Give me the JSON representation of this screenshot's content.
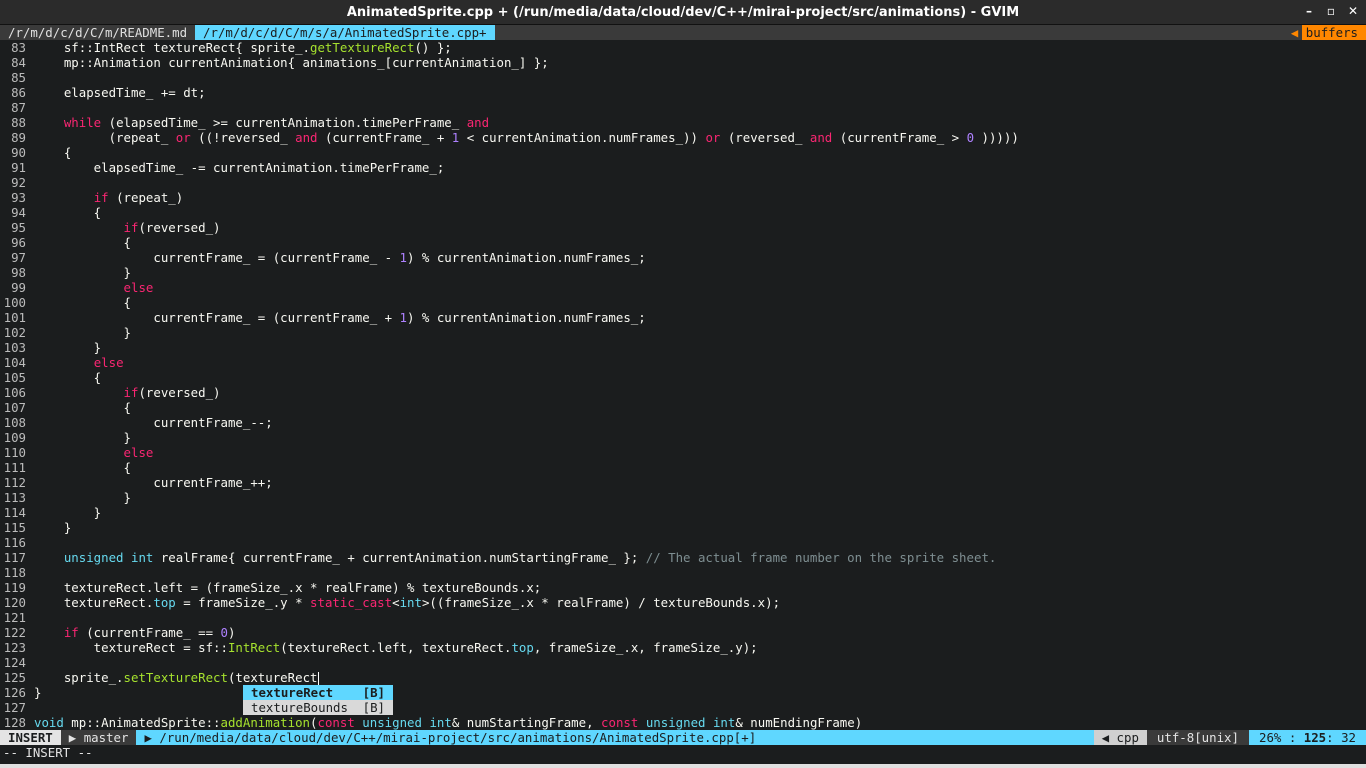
{
  "window": {
    "title": "AnimatedSprite.cpp + (/run/media/data/cloud/dev/C++/mirai-project/src/animations) - GVIM",
    "controls": [
      "–",
      "▫",
      "✕"
    ]
  },
  "tabline": {
    "tabs": [
      {
        "label": "/r/m/d/c/d/C/m/README.md",
        "active": false
      },
      {
        "label": "/r/m/d/c/d/C/m/s/a/AnimatedSprite.cpp+",
        "active": true
      }
    ],
    "right_label": "buffers"
  },
  "editor": {
    "lines": [
      {
        "n": "83",
        "html": "    sf::IntRect textureRect{ sprite_.<span class=\"fn\">getTextureRect</span>() };"
      },
      {
        "n": "84",
        "html": "    mp::Animation currentAnimation{ animations_[currentAnimation_] };"
      },
      {
        "n": "85",
        "html": ""
      },
      {
        "n": "86",
        "html": "    elapsedTime_ += dt;"
      },
      {
        "n": "87",
        "html": ""
      },
      {
        "n": "88",
        "html": "    <span class=\"kw\">while</span> (elapsedTime_ &gt;= currentAnimation.timePerFrame_ <span class=\"kw\">and</span>"
      },
      {
        "n": "89",
        "html": "          (repeat_ <span class=\"kw\">or</span> ((!reversed_ <span class=\"kw\">and</span> (currentFrame_ + <span class=\"num\">1</span> &lt; currentAnimation.numFrames_)) <span class=\"kw\">or</span> (reversed_ <span class=\"kw\">and</span> (currentFrame_ &gt; <span class=\"num\">0</span> )))))"
      },
      {
        "n": "90",
        "html": "    {"
      },
      {
        "n": "91",
        "html": "        elapsedTime_ -= currentAnimation.timePerFrame_;"
      },
      {
        "n": "92",
        "html": ""
      },
      {
        "n": "93",
        "html": "        <span class=\"kw\">if</span> (repeat_)"
      },
      {
        "n": "94",
        "html": "        {"
      },
      {
        "n": "95",
        "html": "            <span class=\"kw\">if</span>(reversed_)"
      },
      {
        "n": "96",
        "html": "            {"
      },
      {
        "n": "97",
        "html": "                currentFrame_ = (currentFrame_ - <span class=\"num\">1</span>) % currentAnimation.numFrames_;"
      },
      {
        "n": "98",
        "html": "            }"
      },
      {
        "n": "99",
        "html": "            <span class=\"kw\">else</span>"
      },
      {
        "n": "100",
        "html": "            {"
      },
      {
        "n": "101",
        "html": "                currentFrame_ = (currentFrame_ + <span class=\"num\">1</span>) % currentAnimation.numFrames_;"
      },
      {
        "n": "102",
        "html": "            }"
      },
      {
        "n": "103",
        "html": "        }"
      },
      {
        "n": "104",
        "html": "        <span class=\"kw\">else</span>"
      },
      {
        "n": "105",
        "html": "        {"
      },
      {
        "n": "106",
        "html": "            <span class=\"kw\">if</span>(reversed_)"
      },
      {
        "n": "107",
        "html": "            {"
      },
      {
        "n": "108",
        "html": "                currentFrame_--;"
      },
      {
        "n": "109",
        "html": "            }"
      },
      {
        "n": "110",
        "html": "            <span class=\"kw\">else</span>"
      },
      {
        "n": "111",
        "html": "            {"
      },
      {
        "n": "112",
        "html": "                currentFrame_++;"
      },
      {
        "n": "113",
        "html": "            }"
      },
      {
        "n": "114",
        "html": "        }"
      },
      {
        "n": "115",
        "html": "    }"
      },
      {
        "n": "116",
        "html": ""
      },
      {
        "n": "117",
        "html": "    <span class=\"ty\">unsigned</span> <span class=\"ty\">int</span> realFrame{ currentFrame_ + currentAnimation.numStartingFrame_ }; <span class=\"cm\">// The actual frame number on the sprite sheet.</span>"
      },
      {
        "n": "118",
        "html": ""
      },
      {
        "n": "119",
        "html": "    textureRect.left = (frameSize_.x * realFrame) % textureBounds.x;"
      },
      {
        "n": "120",
        "html": "    textureRect.<span class=\"ty\">top</span> = frameSize_.y * <span class=\"kw\">static_cast</span>&lt;<span class=\"ty\">int</span>&gt;((frameSize_.x * realFrame) / textureBounds.x);"
      },
      {
        "n": "121",
        "html": ""
      },
      {
        "n": "122",
        "html": "    <span class=\"kw\">if</span> (currentFrame_ == <span class=\"num\">0</span>)"
      },
      {
        "n": "123",
        "html": "        textureRect = sf::<span class=\"fn\">IntRect</span>(textureRect.left, textureRect.<span class=\"ty\">top</span>, frameSize_.x, frameSize_.y);"
      },
      {
        "n": "124",
        "html": ""
      },
      {
        "n": "125",
        "html": "    sprite_.<span class=\"fn\">setTextureRect</span>(textureRect<span class=\"cursor\"></span>"
      },
      {
        "n": "126",
        "html": "}"
      },
      {
        "n": "127",
        "html": ""
      },
      {
        "n": "128",
        "html": "<span class=\"ty\">void</span> mp::AnimatedSprite::<span class=\"fn\">addAnimation</span>(<span class=\"kw\">const</span> <span class=\"ty\">unsigned</span> <span class=\"ty\">int</span>&amp; numStartingFrame, <span class=\"kw\">const</span> <span class=\"ty\">unsigned</span> <span class=\"ty\">int</span>&amp; numEndingFrame)"
      }
    ]
  },
  "completion": {
    "items": [
      {
        "word": "textureRect",
        "kind": "[B]",
        "selected": true
      },
      {
        "word": "textureBounds",
        "kind": "[B]",
        "selected": false
      }
    ]
  },
  "statusline": {
    "mode": "INSERT",
    "branch": "master",
    "path": "/run/media/data/cloud/dev/C++/mirai-project/src/animations/AnimatedSprite.cpp[+]",
    "filetype": "cpp",
    "encoding": "utf-8[unix]",
    "percent": "26%",
    "line": "125",
    "col": "32"
  },
  "cmdline": "-- INSERT --"
}
